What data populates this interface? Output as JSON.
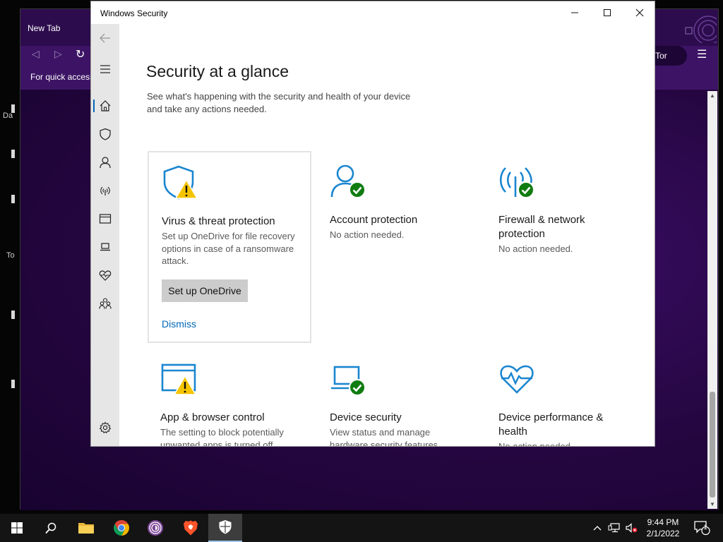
{
  "desktop": {
    "left_glyphs": [
      "Da",
      "To"
    ]
  },
  "browser": {
    "tab_title": "New Tab",
    "quick_access_text": "For quick access",
    "tor_button_label": "th Tor"
  },
  "window": {
    "title": "Windows Security",
    "controls": {
      "minimize": "minimize",
      "maximize": "maximize",
      "close": "close"
    }
  },
  "sidebar": {
    "items": [
      {
        "name": "home-icon"
      },
      {
        "name": "shield-icon"
      },
      {
        "name": "account-icon"
      },
      {
        "name": "network-icon"
      },
      {
        "name": "app-browser-icon"
      },
      {
        "name": "device-icon"
      },
      {
        "name": "heart-icon"
      },
      {
        "name": "family-icon"
      }
    ],
    "settings": {
      "name": "settings-icon"
    },
    "active_index": 0
  },
  "main": {
    "title": "Security at a glance",
    "subtitle_line1": "See what's happening with the security and health of your device",
    "subtitle_line2": "and take any actions needed."
  },
  "cards": {
    "virus": {
      "title": "Virus & threat protection",
      "desc_line1": "Set up OneDrive for file recovery",
      "desc_line2": "options in case of a ransomware",
      "desc_line3": "attack.",
      "button": "Set up OneDrive",
      "link": "Dismiss",
      "status": "warning"
    },
    "account": {
      "title": "Account protection",
      "desc": "No action needed.",
      "status": "ok"
    },
    "firewall": {
      "title_line1": "Firewall & network",
      "title_line2": "protection",
      "desc": "No action needed.",
      "status": "ok"
    },
    "app_browser": {
      "title": "App & browser control",
      "desc_line1": "The setting to block potentially",
      "desc_line2": "unwanted apps is turned off.",
      "status": "warning"
    },
    "device_security": {
      "title": "Device security",
      "desc_line1": "View status and manage",
      "desc_line2": "hardware security features",
      "status": "ok"
    },
    "device_performance": {
      "title_line1": "Device performance &",
      "title_line2": "health",
      "desc": "No action needed.",
      "status": "ok"
    }
  },
  "taskbar": {
    "apps": [
      "start",
      "search",
      "file-explorer",
      "chrome",
      "tor-browser",
      "brave",
      "windows-security"
    ],
    "clock_time": "9:44 PM",
    "clock_date": "2/1/2022",
    "notification_count": "1"
  },
  "colors": {
    "accent": "#0067b8",
    "icon_blue": "#1a86d0",
    "ok_green": "#107c10",
    "warning_yellow": "#f5c400",
    "browser_purple": "#3d1465"
  }
}
